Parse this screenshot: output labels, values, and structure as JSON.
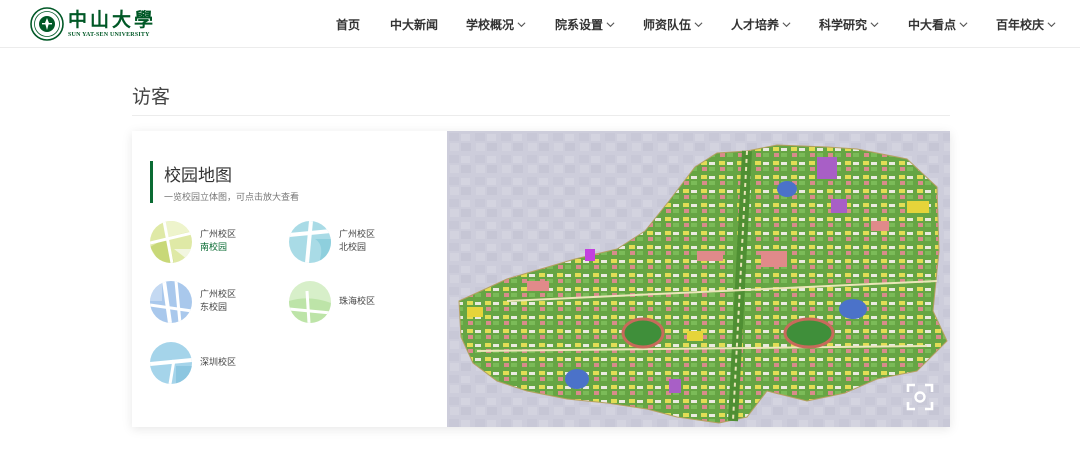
{
  "header": {
    "logo_cn": "中山大學",
    "logo_en": "SUN YAT-SEN UNIVERSITY",
    "nav": [
      {
        "label": "首页",
        "dropdown": false
      },
      {
        "label": "中大新闻",
        "dropdown": false
      },
      {
        "label": "学校概况",
        "dropdown": true
      },
      {
        "label": "院系设置",
        "dropdown": true
      },
      {
        "label": "师资队伍",
        "dropdown": true
      },
      {
        "label": "人才培养",
        "dropdown": true
      },
      {
        "label": "科学研究",
        "dropdown": true
      },
      {
        "label": "中大看点",
        "dropdown": true
      },
      {
        "label": "百年校庆",
        "dropdown": true
      }
    ]
  },
  "page": {
    "title": "访客"
  },
  "card": {
    "heading": "校园地图",
    "subtitle": "一览校园立体图，可点击放大查看",
    "campuses": [
      {
        "line1": "广州校区",
        "line2": "南校园",
        "thumb": "south-campus-thumb",
        "active": true
      },
      {
        "line1": "广州校区",
        "line2": "北校园",
        "thumb": "north-campus-thumb",
        "active": false
      },
      {
        "line1": "广州校区",
        "line2": "东校园",
        "thumb": "east-campus-thumb",
        "active": false
      },
      {
        "line1": "珠海校区",
        "line2": "",
        "thumb": "zhuhai-campus-thumb",
        "active": false
      },
      {
        "line1": "深圳校区",
        "line2": "",
        "thumb": "shenzhen-campus-thumb",
        "active": false
      }
    ],
    "zoom_icon": "fullscreen-zoom-icon"
  },
  "colors": {
    "brand_green": "#005826",
    "accent_green": "#0a6b33",
    "map_green": "#6fae4a"
  }
}
